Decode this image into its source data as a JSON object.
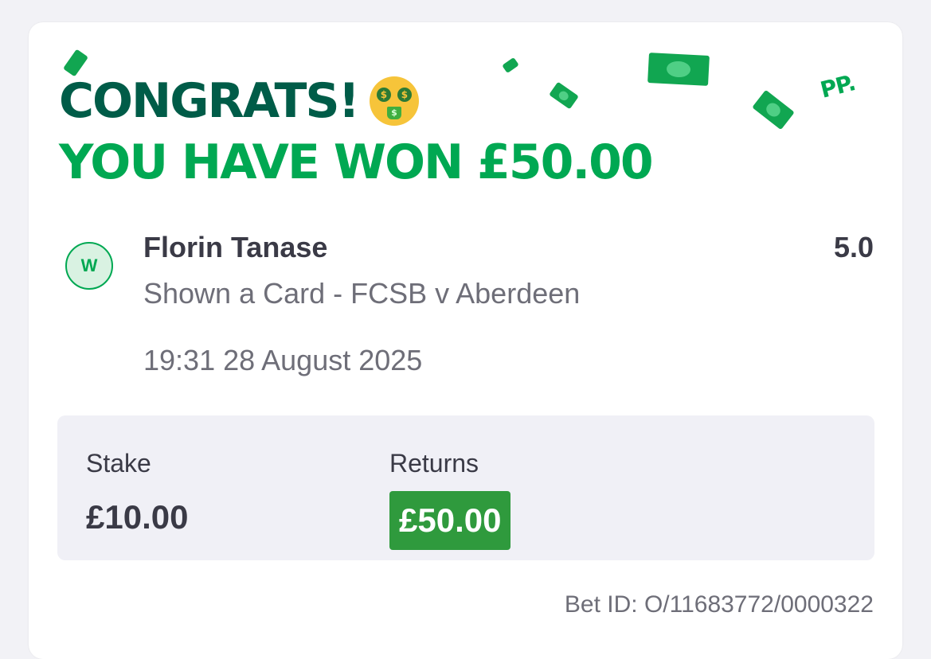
{
  "header": {
    "congrats": "CONGRATS!",
    "emoji_icon": "money-mouth-face-icon",
    "won_text": "YOU HAVE WON £50.00",
    "brand_logo": "PP."
  },
  "selection": {
    "status_badge": "W",
    "name": "Florin Tanase",
    "odds": "5.0",
    "market": "Shown a Card - FCSB v Aberdeen",
    "datetime": "19:31 28 August 2025"
  },
  "summary": {
    "stake_label": "Stake",
    "stake_value": "£10.00",
    "returns_label": "Returns",
    "returns_value": "£50.00"
  },
  "footer": {
    "bet_id": "Bet ID: O/11683772/0000322"
  },
  "colors": {
    "dark_green": "#005c48",
    "brand_green": "#00a852",
    "returns_green": "#2f9a3d",
    "text_dark": "#3a3a46",
    "text_muted": "#6e6e78"
  }
}
